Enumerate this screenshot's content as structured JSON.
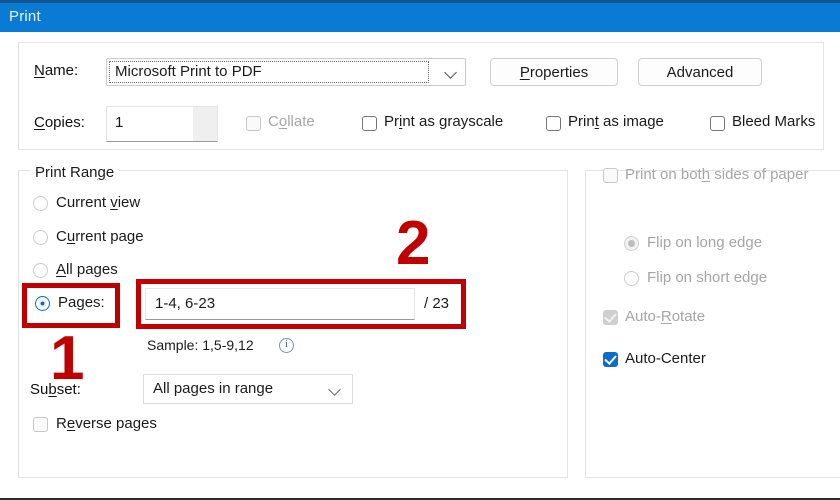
{
  "window": {
    "title": "Print"
  },
  "printer": {
    "name_label": "Name:",
    "name_label_mnemonic": "N",
    "name_value": "Microsoft Print to PDF",
    "properties_label": "Properties",
    "advanced_label": "Advanced",
    "copies_label": "Copies:",
    "copies_value": "1",
    "options": [
      {
        "label": "Collate",
        "checked": false,
        "enabled": false
      },
      {
        "label": "Print as grayscale",
        "checked": false,
        "enabled": true
      },
      {
        "label": "Print as image",
        "checked": false,
        "enabled": true
      },
      {
        "label": "Bleed Marks",
        "checked": false,
        "enabled": true
      }
    ]
  },
  "print_range": {
    "legend": "Print Range",
    "radios": [
      {
        "label": "Current view",
        "selected": false
      },
      {
        "label": "Current page",
        "selected": false
      },
      {
        "label": "All pages",
        "selected": false
      },
      {
        "label": "Pages:",
        "selected": true
      }
    ],
    "pages_value": "1-4, 6-23",
    "pages_total": "/ 23",
    "sample_text": "Sample: 1,5-9,12",
    "info_icon_glyph": "i",
    "subset_label": "Subset:",
    "subset_value": "All pages in range",
    "reverse_label": "Reverse pages",
    "reverse_checked": false
  },
  "page_handling": {
    "both_sides_label": "Print on both sides of paper",
    "both_sides_checked": false,
    "flip_long_label": "Flip on long edge",
    "flip_long_selected": true,
    "flip_short_label": "Flip on short edge",
    "flip_short_selected": false,
    "auto_rotate_label": "Auto-Rotate",
    "auto_rotate_checked": true,
    "auto_center_label": "Auto-Center",
    "auto_center_checked": true
  },
  "annotations": {
    "marker_1": "1",
    "marker_2": "2",
    "color": "#c00000"
  },
  "colors": {
    "titlebar": "#0a7bd4",
    "accent": "#0a6ccd",
    "annotation_red": "#c00000"
  }
}
